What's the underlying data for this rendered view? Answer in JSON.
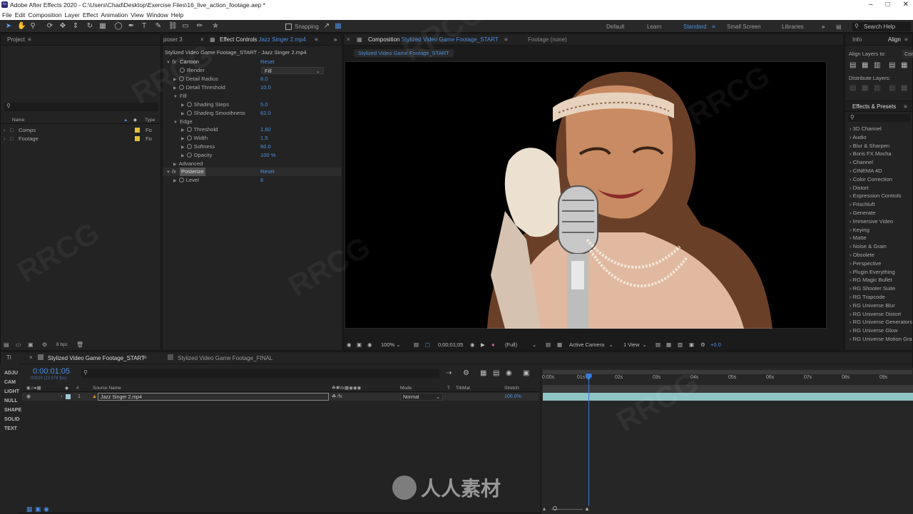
{
  "window": {
    "title": "Adobe After Effects 2020 - C:\\Users\\Chad\\Desktop\\Exercise Files\\16_live_action_footage.aep *"
  },
  "menu": [
    "File",
    "Edit",
    "Composition",
    "Layer",
    "Effect",
    "Animation",
    "View",
    "Window",
    "Help"
  ],
  "toolbar": {
    "snapping_label": "Snapping",
    "search_help_placeholder": "Search Help"
  },
  "workspaces": [
    "Default",
    "Learn",
    "Standard",
    "Small Screen",
    "Libraries"
  ],
  "project": {
    "tab": "Project",
    "col_name": "Name",
    "col_type": "Type",
    "items": [
      {
        "name": "Comps",
        "type": "Fo"
      },
      {
        "name": "Footage",
        "type": "Fo"
      }
    ],
    "bpc": "8 bpc"
  },
  "effect_controls": {
    "tab_prev": "poser 3",
    "tab_label": "Effect Controls",
    "tab_layer": "Jazz Singer 2.mp4",
    "header": "Stylized Video Game Footage_START - Jazz Singer 2.mp4",
    "cartoon": "Cartoon",
    "posterize": "Posterize",
    "reset": "Reset",
    "render": "Render",
    "render_value": "Fill",
    "detail_radius": "Detail Radius",
    "detail_radius_val": "8.0",
    "detail_threshold": "Detail Threshold",
    "detail_threshold_val": "10.0",
    "fill": "Fill",
    "shading_steps": "Shading Steps",
    "shading_steps_val": "5.0",
    "shading_smoothness": "Shading Smoothness",
    "shading_smoothness_val": "62.0",
    "edge": "Edge",
    "threshold": "Threshold",
    "threshold_val": "1.60",
    "width": "Width",
    "width_val": "1.5",
    "softness": "Softness",
    "softness_val": "60.0",
    "opacity": "Opacity",
    "opacity_val": "100 %",
    "advanced": "Advanced",
    "level": "Level",
    "level_val": "8"
  },
  "composition": {
    "tab_label": "Composition",
    "tab_name": "Stylized Video Game Footage_START",
    "footage_tab": "Footage (none)",
    "subtab": "Stylized Video Game Footage_START",
    "zoom": "100%",
    "timecode": "0;00;01;05",
    "resolution": "(Full)",
    "camera": "Active Camera",
    "views": "1 View",
    "exposure": "+0.0"
  },
  "right": {
    "info_tab": "Info",
    "align_tab": "Align",
    "align_layers_to": "Align Layers to:",
    "align_to_value": "Compo",
    "distribute_layers": "Distribute Layers:",
    "effects_tab": "Effects & Presets",
    "effects": [
      "3D Channel",
      "Audio",
      "Blur & Sharpen",
      "Boris FX Mocha",
      "Channel",
      "CINEMA 4D",
      "Color Correction",
      "Distort",
      "Expression Controls",
      "Frischluft",
      "Generate",
      "Immersive Video",
      "Keying",
      "Matte",
      "Noise & Grain",
      "Obsolete",
      "Perspective",
      "Plugin Everything",
      "RG Magic Bullet",
      "RG Shooter Suite",
      "RG Trapcode",
      "RG Universe Blur",
      "RG Universe Distort",
      "RG Universe Generators",
      "RG Universe Glow",
      "RG Universe Motion Gra"
    ]
  },
  "timeline": {
    "tab_active": "Stylized Video Game Footage_START",
    "tab_other": "Stylized Video Game Footage_FINAL",
    "timecode": "0:00:01:05",
    "frames": "00029 (23.976 fps)",
    "col_source": "Source Name",
    "col_mode": "Mode",
    "col_t": "T",
    "col_trkmat": "TrkMat",
    "col_stretch": "Stretch",
    "layer_num": "1",
    "layer_name": "Jazz Singer 2.mp4",
    "layer_mode": "Normal",
    "layer_stretch": "100.0%",
    "ticks": [
      "0:00s",
      "01s",
      "02s",
      "03s",
      "04s",
      "05s",
      "06s",
      "07s",
      "08s",
      "09s"
    ],
    "playhead_seconds": 1.2
  },
  "layer_types": [
    "ADJU",
    "CAM",
    "LIGHT",
    "NULL",
    "SHAPE",
    "SOLID",
    "TEXT"
  ],
  "watermark": {
    "logo_text": "人人素材",
    "text": "RRCG"
  }
}
